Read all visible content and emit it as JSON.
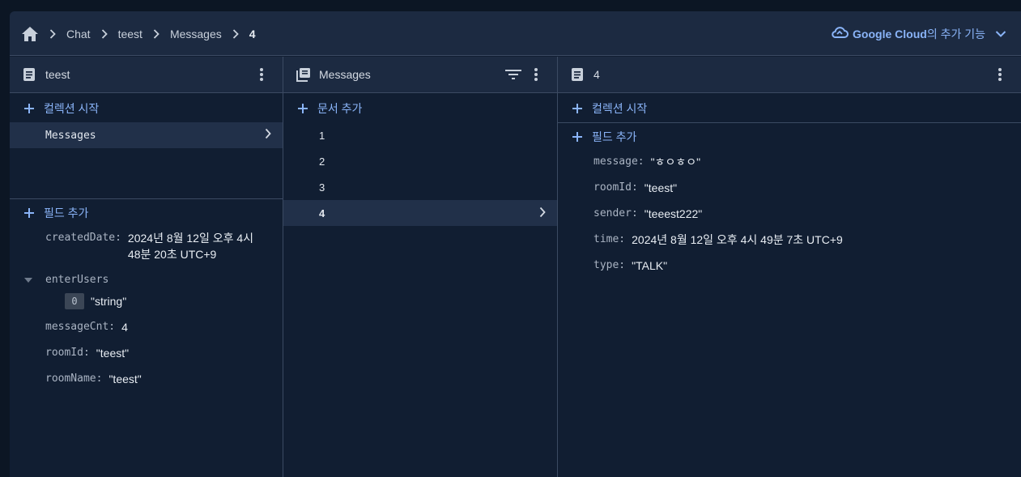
{
  "breadcrumb": {
    "items": [
      "Chat",
      "teest",
      "Messages"
    ],
    "current": "4"
  },
  "gcloud": {
    "label": "Google Cloud",
    "suffix": "의 추가 기능"
  },
  "col1": {
    "title": "teest",
    "add_collection": "컬렉션 시작",
    "collections": [
      "Messages"
    ],
    "add_field": "필드 추가",
    "fields": {
      "createdDate": {
        "key": "createdDate:",
        "value_line1": "2024년 8월 12일 오후 4시",
        "value_line2": "48분 20초 UTC+9"
      },
      "enterUsers": {
        "key": "enterUsers",
        "items": [
          {
            "index": "0",
            "value": "\"string\""
          }
        ]
      },
      "messageCnt": {
        "key": "messageCnt:",
        "value": "4"
      },
      "roomId": {
        "key": "roomId:",
        "value": "\"teest\""
      },
      "roomName": {
        "key": "roomName:",
        "value": "\"teest\""
      }
    }
  },
  "col2": {
    "title": "Messages",
    "add_document": "문서 추가",
    "documents": [
      "1",
      "2",
      "3",
      "4"
    ]
  },
  "col3": {
    "title": "4",
    "add_collection": "컬렉션 시작",
    "add_field": "필드 추가",
    "fields": [
      {
        "key": "message:",
        "value": "\"ㅎㅇㅎㅇ\""
      },
      {
        "key": "roomId:",
        "value": "\"teest\""
      },
      {
        "key": "sender:",
        "value": "\"teeest222\""
      },
      {
        "key": "time:",
        "value": "2024년 8월 12일 오후 4시 49분 7초 UTC+9"
      },
      {
        "key": "type:",
        "value": "\"TALK\""
      }
    ]
  },
  "colors": {
    "background": "#0c1624",
    "panel": "#111e32",
    "header": "#1c2a41",
    "selected_row": "#213049",
    "accent": "#8ab4f8",
    "border": "#3b4a62"
  }
}
